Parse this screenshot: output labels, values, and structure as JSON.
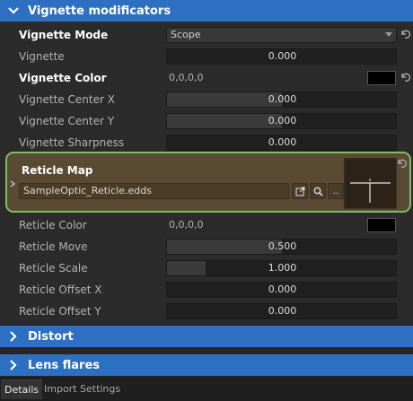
{
  "sections": {
    "vignette": "Vignette modificators",
    "distort": "Distort",
    "lens_flares": "Lens flares"
  },
  "vignette_rows": {
    "mode": {
      "label": "Vignette Mode",
      "value": "Scope"
    },
    "vignette": {
      "label": "Vignette",
      "value": "0.000"
    },
    "color": {
      "label": "Vignette Color",
      "value": "0,0,0,0"
    },
    "center_x": {
      "label": "Vignette Center X",
      "value": "0.000"
    },
    "center_y": {
      "label": "Vignette Center Y",
      "value": "0.000"
    },
    "sharpness": {
      "label": "Vignette Sharpness",
      "value": "0.000"
    }
  },
  "reticle_map": {
    "label": "Reticle Map",
    "path": "SampleOptic_Reticle.edds",
    "browse_label": ".."
  },
  "reticle_rows": {
    "color": {
      "label": "Reticle Color",
      "value": "0,0,0,0"
    },
    "move": {
      "label": "Reticle Move",
      "value": "0.500"
    },
    "scale": {
      "label": "Reticle Scale",
      "value": "1.000"
    },
    "offset_x": {
      "label": "Reticle Offset X",
      "value": "0.000"
    },
    "offset_y": {
      "label": "Reticle Offset Y",
      "value": "0.000"
    }
  },
  "slider_levels": {
    "reticle_move": 0.5,
    "reticle_scale": 0.17,
    "vignette_center_x": 0.5,
    "vignette_center_y": 0.5
  },
  "tabs": [
    "Details",
    "Import Settings"
  ],
  "colors": {
    "section_header": "#2d6fc1",
    "highlight_border": "#7bbf63",
    "highlight_bg": "#5a4a34",
    "swatch": "#000000"
  },
  "icons": {
    "expanded": "chevron-down-icon",
    "collapsed": "chevron-right-icon",
    "reset": "undo-icon",
    "open_external": "open-external-icon",
    "search": "search-icon"
  }
}
